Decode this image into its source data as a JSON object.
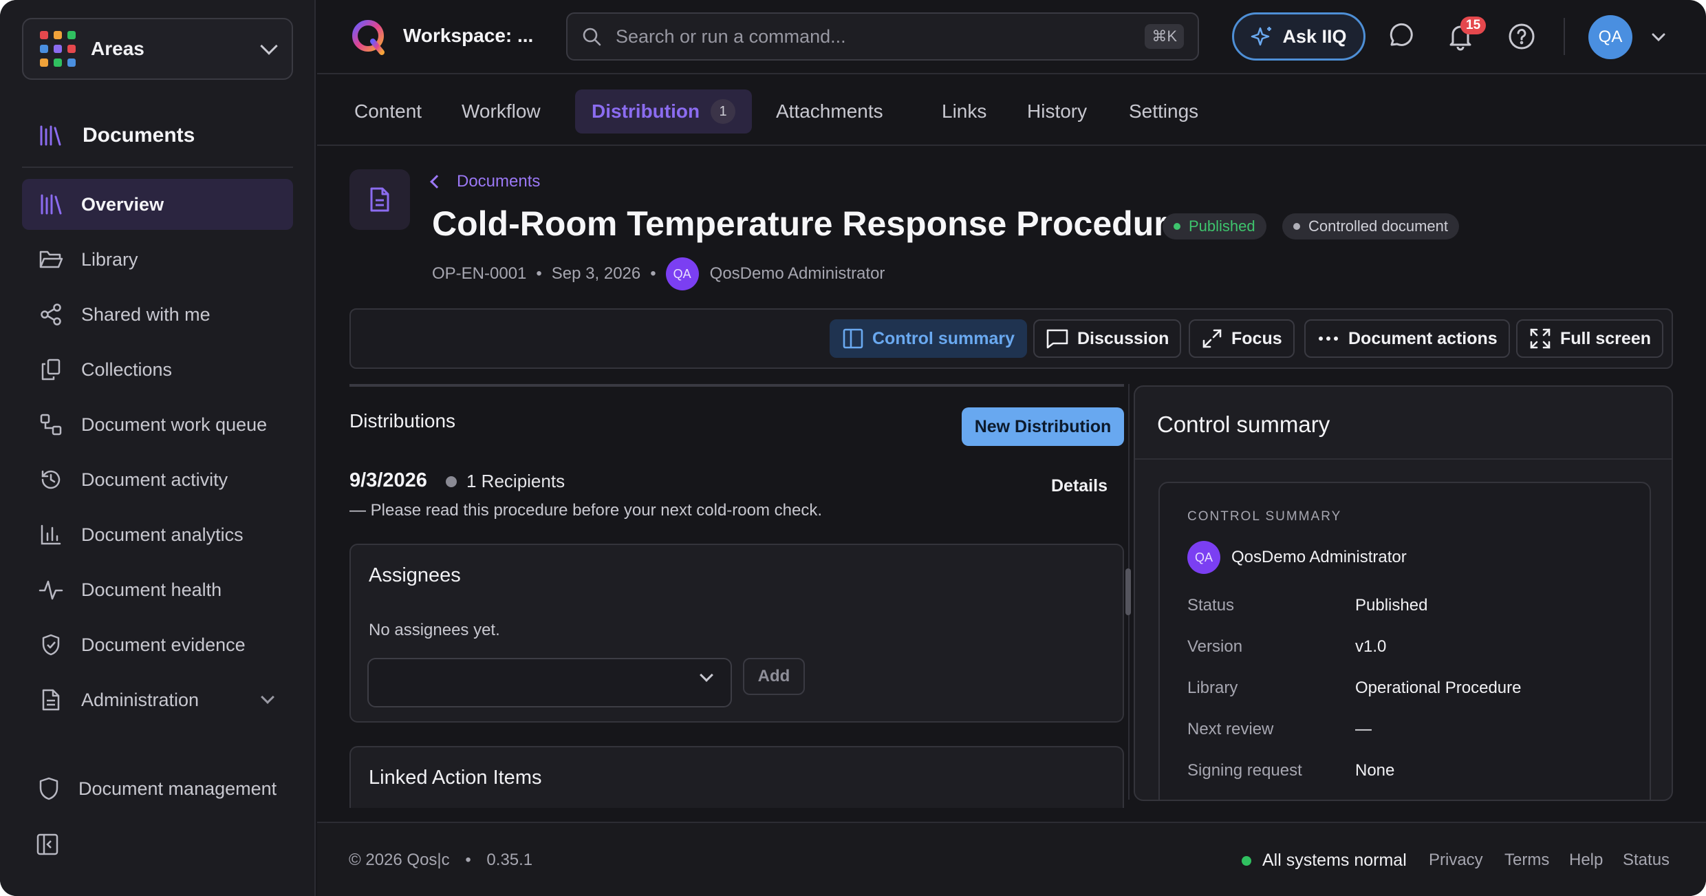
{
  "sidebar": {
    "areas_label": "Areas",
    "section_title": "Documents",
    "items": [
      {
        "label": "Overview",
        "icon": "library-icon",
        "active": true
      },
      {
        "label": "Library",
        "icon": "folder-open-icon"
      },
      {
        "label": "Shared with me",
        "icon": "share-icon"
      },
      {
        "label": "Collections",
        "icon": "copy-icon"
      },
      {
        "label": "Document work queue",
        "icon": "workflow-icon"
      },
      {
        "label": "Document activity",
        "icon": "history-icon"
      },
      {
        "label": "Document analytics",
        "icon": "bar-chart-icon"
      },
      {
        "label": "Document health",
        "icon": "activity-icon"
      },
      {
        "label": "Document evidence",
        "icon": "shield-check-icon"
      },
      {
        "label": "Administration",
        "icon": "file-text-icon"
      }
    ],
    "bottom_item": "Document management"
  },
  "topbar": {
    "workspace": "Workspace: ...",
    "search_placeholder": "Search or run a command...",
    "shortcut": "⌘K",
    "ask_label": "Ask IIQ",
    "notification_count": "15",
    "avatar_initials": "QA"
  },
  "tabs": [
    {
      "label": "Content"
    },
    {
      "label": "Workflow"
    },
    {
      "label": "Distribution",
      "count": "1",
      "active": true
    },
    {
      "label": "Attachments"
    },
    {
      "label": "Links"
    },
    {
      "label": "History"
    },
    {
      "label": "Settings"
    }
  ],
  "document": {
    "breadcrumb": "Documents",
    "title": "Cold-Room Temperature Response Procedure",
    "status_pill": "Published",
    "control_pill": "Controlled document",
    "doc_id": "OP-EN-0001",
    "date": "Sep 3, 2026",
    "author_initials": "QA",
    "author": "QosDemo Administrator"
  },
  "toolbar": {
    "control_summary": "Control summary",
    "discussion": "Discussion",
    "focus": "Focus",
    "document_actions": "Document actions",
    "full_screen": "Full screen"
  },
  "distributions": {
    "title": "Distributions",
    "new_button": "New Distribution",
    "entry_date": "9/3/2026",
    "entry_recipients": "1 Recipients",
    "details_link": "Details",
    "entry_note": "— Please read this procedure before your next cold-room check.",
    "assignees_title": "Assignees",
    "no_assignees": "No assignees yet.",
    "add_button": "Add",
    "linked_title": "Linked Action Items"
  },
  "control_summary": {
    "panel_title": "Control summary",
    "section_label": "CONTROL SUMMARY",
    "user_initials": "QA",
    "user_name": "QosDemo Administrator",
    "rows": [
      {
        "label": "Status",
        "value": "Published"
      },
      {
        "label": "Version",
        "value": "v1.0"
      },
      {
        "label": "Library",
        "value": "Operational Procedure"
      },
      {
        "label": "Next review",
        "value": "—"
      },
      {
        "label": "Signing request",
        "value": "None"
      }
    ]
  },
  "footer": {
    "copyright": "© 2026 Qos|c",
    "version": "0.35.1",
    "status": "All systems normal",
    "links": [
      "Privacy",
      "Terms",
      "Help",
      "Status"
    ]
  },
  "colors": {
    "accent_purple": "#8b6cf0",
    "accent_blue": "#68a8f0",
    "success": "#30c060",
    "alert": "#e5484d"
  }
}
